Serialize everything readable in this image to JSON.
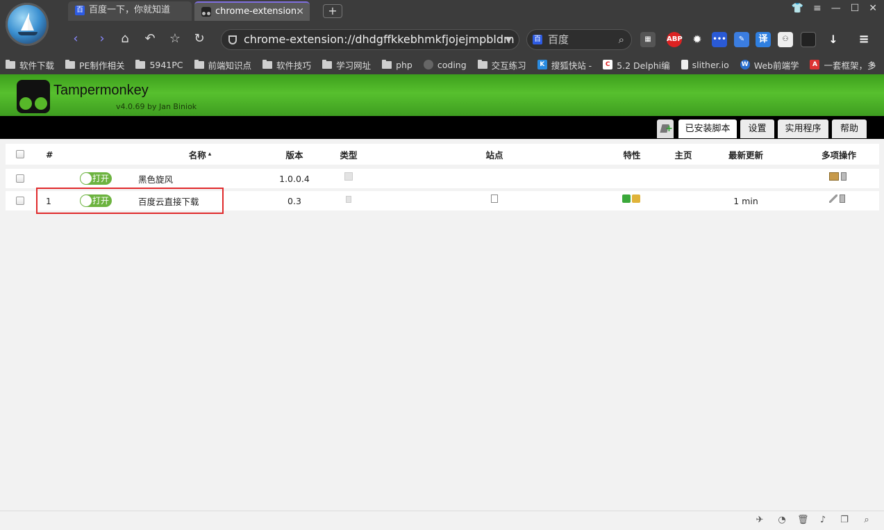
{
  "browser": {
    "tabs": [
      {
        "title": "百度一下，你就知道"
      },
      {
        "title": "chrome-extension:"
      }
    ],
    "url": "chrome-extension://dhdgffkkebhmkfjojejmpbldm",
    "search_engine": "百度",
    "extensions": [
      "ABP",
      "译"
    ],
    "bookmarks": [
      "软件下载",
      "PE制作相关",
      "5941PC",
      "前端知识点",
      "软件技巧",
      "学习网址",
      "php",
      "coding",
      "交互练习",
      "搜狐快站 -",
      "5.2 Delphi编",
      "slither.io",
      "Web前端学",
      "一套框架，多"
    ],
    "colors": {
      "chrome_bg": "#3c3c3c",
      "tm_green": "#57c02e",
      "highlight": "#e0292b"
    }
  },
  "app": {
    "name": "Tampermonkey",
    "version": "v4.0.69 by Jan Biniok",
    "tabs": [
      "已安装脚本",
      "设置",
      "实用程序",
      "帮助"
    ],
    "active_tab": "已安装脚本"
  },
  "table": {
    "headers": {
      "num": "#",
      "name": "名称",
      "version": "版本",
      "type": "类型",
      "sites": "站点",
      "features": "特性",
      "homepage": "主页",
      "updated": "最新更新",
      "actions": "多项操作"
    },
    "sort_indicator": "▴",
    "rows": [
      {
        "num": "",
        "toggle": "打开",
        "name": "黑色旋风",
        "version": "1.0.0.4",
        "updated": ""
      },
      {
        "num": "1",
        "toggle": "打开",
        "name": "百度云直接下载",
        "version": "0.3",
        "updated": "1 min"
      }
    ]
  }
}
